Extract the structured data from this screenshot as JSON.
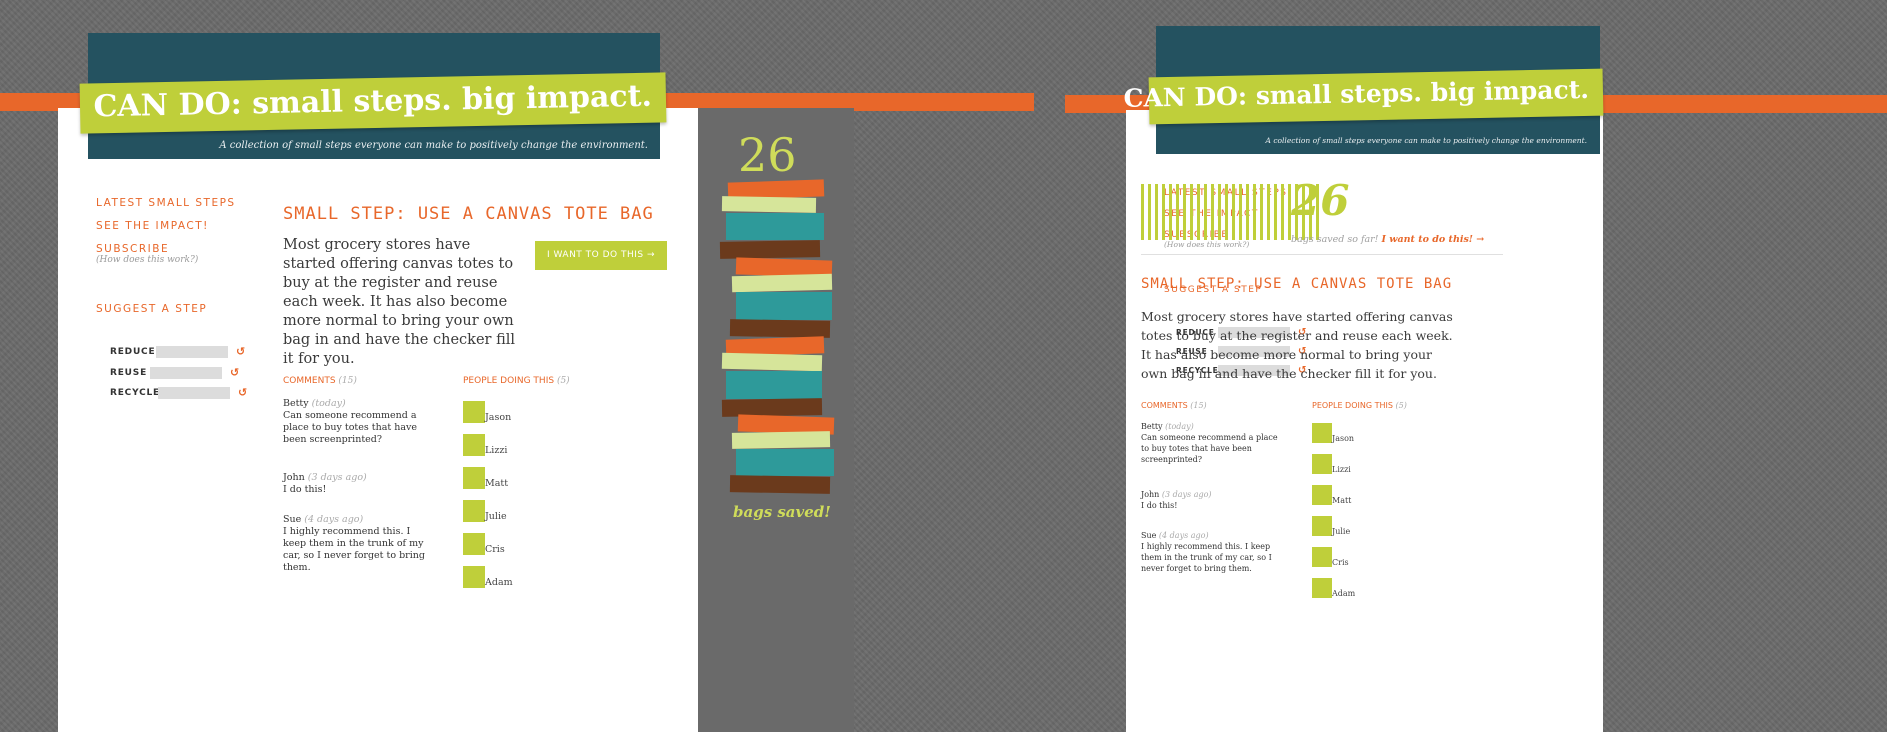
{
  "colors": {
    "orange": "#e8672a",
    "teal": "#245260",
    "lime": "#bfcf3a",
    "background": "#6b6b6b"
  },
  "site": {
    "title": "CAN DO: small steps. big impact.",
    "tagline": "A collection of small steps everyone can make to positively change the environment."
  },
  "nav": {
    "latest": "LATEST SMALL STEPS",
    "impact": "SEE THE IMPACT!",
    "subscribe": "SUBSCRIBE",
    "subscribe_help": "(How does this work?)",
    "suggest": "SUGGEST A STEP"
  },
  "suggest_rows": [
    {
      "label": "REDUCE",
      "icon": "refresh-icon",
      "glyph": "↺"
    },
    {
      "label": "REUSE",
      "icon": "refresh-icon",
      "glyph": "↺"
    },
    {
      "label": "RECYCLE",
      "icon": "refresh-icon",
      "glyph": "↺"
    }
  ],
  "step": {
    "title": "SMALL STEP: USE A CANVAS TOTE BAG",
    "body": "Most grocery stores have started offering canvas totes to buy at the register and reuse each week. It has also become more normal to bring your own bag in and have the checker fill it for you.",
    "cta_label": "I WANT TO DO THIS →"
  },
  "comments": {
    "header": "COMMENTS",
    "count": "(15)",
    "items": [
      {
        "author": "Betty",
        "when": "(today)",
        "text": "Can someone recommend a place to buy totes that have been screenprinted?"
      },
      {
        "author": "John",
        "when": "(3 days ago)",
        "text": "I do this!"
      },
      {
        "author": "Sue",
        "when": "(4 days ago)",
        "text": "I highly recommend this. I keep them in the trunk of my car, so I never forget to bring them."
      }
    ]
  },
  "people": {
    "header": "PEOPLE DOING THIS",
    "count": "(5)",
    "names": [
      "Jason",
      "Lizzi",
      "Matt",
      "Julie",
      "Cris",
      "Adam"
    ]
  },
  "impact": {
    "count": "26",
    "caption": "bags saved!",
    "inline_text": "bags saved so far!",
    "inline_link": "I want to do this! →"
  }
}
